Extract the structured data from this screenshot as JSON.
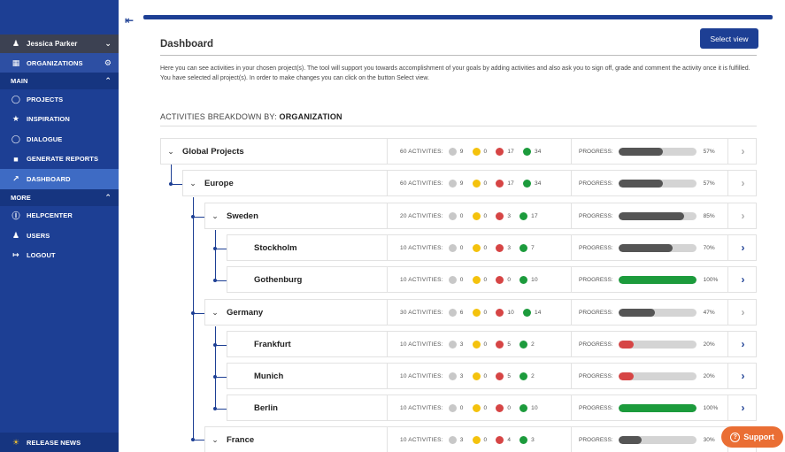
{
  "sidebar": {
    "user": "Jessica Parker",
    "organizations": "ORGANIZATIONS",
    "main_label": "MAIN",
    "main_items": [
      {
        "label": "PROJECTS",
        "icon": "lightbulb-icon"
      },
      {
        "label": "INSPIRATION",
        "icon": "inspiration-icon"
      },
      {
        "label": "DIALOGUE",
        "icon": "chat-bubble-icon"
      },
      {
        "label": "GENERATE REPORTS",
        "icon": "report-icon"
      },
      {
        "label": "DASHBOARD",
        "icon": "chart-icon"
      }
    ],
    "more_label": "MORE",
    "more_items": [
      {
        "label": "HELPCENTER",
        "icon": "help-icon"
      },
      {
        "label": "USERS",
        "icon": "users-icon"
      },
      {
        "label": "LOGOUT",
        "icon": "logout-icon"
      }
    ],
    "release_news": "RELEASE NEWS"
  },
  "page": {
    "title": "Dashboard",
    "select_view": "Select view",
    "description": "Here you can see activities in your chosen project(s). The tool will support you towards accomplishment of your goals by adding activities and also ask you to sign off, grade and comment the activity once it is fulfilled. You have selected all project(s). In order to make changes you can click on the button Select view.",
    "breakdown_prefix": "ACTIVITIES BREAKDOWN BY:",
    "breakdown_value": "ORGANIZATION"
  },
  "labels": {
    "progress": "PROGRESS:"
  },
  "colors": {
    "brand": "#1d3f94",
    "progress_dark": "#555555",
    "progress_green": "#1c9b3c",
    "progress_red": "#d64545",
    "support": "#ea6e34"
  },
  "rows": [
    {
      "name": "Global Projects",
      "activities": "60 ACTIVITIES:",
      "grey": "9",
      "yellow": "0",
      "red": "17",
      "green": "34",
      "progress": 57,
      "progress_label": "57%"
    },
    {
      "name": "Europe",
      "activities": "60 ACTIVITIES:",
      "grey": "9",
      "yellow": "0",
      "red": "17",
      "green": "34",
      "progress": 57,
      "progress_label": "57%"
    },
    {
      "name": "Sweden",
      "activities": "20 ACTIVITIES:",
      "grey": "0",
      "yellow": "0",
      "red": "3",
      "green": "17",
      "progress": 85,
      "progress_label": "85%"
    },
    {
      "name": "Stockholm",
      "activities": "10 ACTIVITIES:",
      "grey": "0",
      "yellow": "0",
      "red": "3",
      "green": "7",
      "progress": 70,
      "progress_label": "70%"
    },
    {
      "name": "Gothenburg",
      "activities": "10 ACTIVITIES:",
      "grey": "0",
      "yellow": "0",
      "red": "0",
      "green": "10",
      "progress": 100,
      "progress_label": "100%"
    },
    {
      "name": "Germany",
      "activities": "30 ACTIVITIES:",
      "grey": "6",
      "yellow": "0",
      "red": "10",
      "green": "14",
      "progress": 47,
      "progress_label": "47%"
    },
    {
      "name": "Frankfurt",
      "activities": "10 ACTIVITIES:",
      "grey": "3",
      "yellow": "0",
      "red": "5",
      "green": "2",
      "progress": 20,
      "progress_label": "20%"
    },
    {
      "name": "Munich",
      "activities": "10 ACTIVITIES:",
      "grey": "3",
      "yellow": "0",
      "red": "5",
      "green": "2",
      "progress": 20,
      "progress_label": "20%"
    },
    {
      "name": "Berlin",
      "activities": "10 ACTIVITIES:",
      "grey": "0",
      "yellow": "0",
      "red": "0",
      "green": "10",
      "progress": 100,
      "progress_label": "100%"
    },
    {
      "name": "France",
      "activities": "10 ACTIVITIES:",
      "grey": "3",
      "yellow": "0",
      "red": "4",
      "green": "3",
      "progress": 30,
      "progress_label": "30%"
    }
  ],
  "support": "Support"
}
